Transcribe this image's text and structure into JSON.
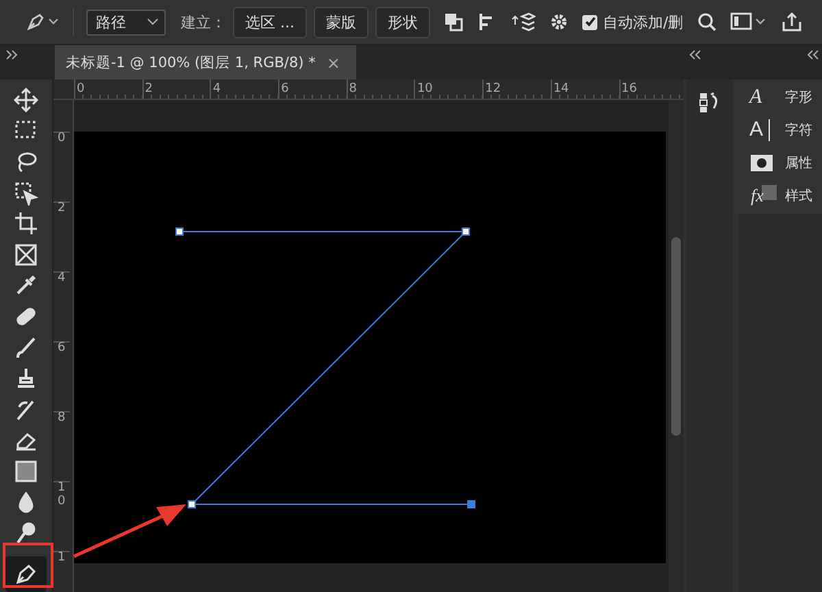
{
  "options_bar": {
    "mode_dropdown": "路径",
    "make_label": "建立：",
    "make_buttons": [
      "选区 ...",
      "蒙版",
      "形状"
    ],
    "auto_add_delete": {
      "label": "自动添加/删",
      "checked": true
    }
  },
  "document_tab": {
    "title": "未标题-1 @ 100% (图层 1, RGB/8) *",
    "close": "×"
  },
  "toolbar": [
    {
      "kind": "move",
      "selected": false
    },
    {
      "kind": "marquee",
      "selected": false
    },
    {
      "kind": "lasso",
      "selected": false
    },
    {
      "kind": "object-select",
      "selected": false
    },
    {
      "kind": "crop",
      "selected": false
    },
    {
      "kind": "frame",
      "selected": false
    },
    {
      "kind": "eyedropper",
      "selected": false
    },
    {
      "kind": "healing",
      "selected": false
    },
    {
      "kind": "brush",
      "selected": false
    },
    {
      "kind": "stamp",
      "selected": false
    },
    {
      "kind": "history-brush",
      "selected": false
    },
    {
      "kind": "eraser",
      "selected": false
    },
    {
      "kind": "gradient",
      "selected": false
    },
    {
      "kind": "blur",
      "selected": false
    },
    {
      "kind": "dodge",
      "selected": false
    },
    {
      "kind": "pen",
      "selected": true
    }
  ],
  "horizontal_ruler": {
    "labels": [
      "0",
      "2",
      "4",
      "6",
      "8",
      "10",
      "12",
      "14",
      "16"
    ]
  },
  "vertical_ruler": {
    "labels": [
      "0",
      "2",
      "4",
      "6",
      "8",
      "10",
      "1"
    ]
  },
  "panels": [
    {
      "kind": "glyphs",
      "glyph": "A",
      "label": "字形"
    },
    {
      "kind": "character",
      "glyph": "A",
      "label": "字符"
    },
    {
      "kind": "properties",
      "label": "属性"
    },
    {
      "kind": "styles",
      "glyph": "fx",
      "label": "样式"
    }
  ]
}
